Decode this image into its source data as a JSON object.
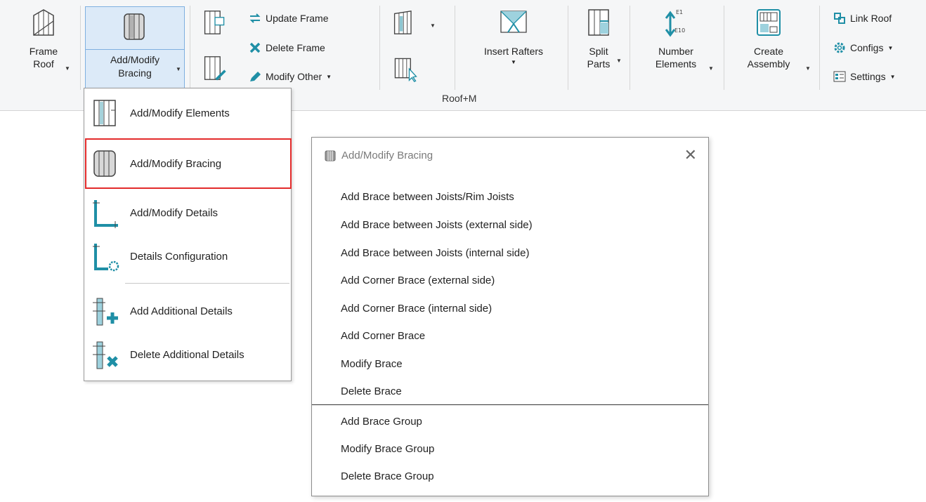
{
  "ribbon": {
    "frame_roof": {
      "line1": "Frame",
      "line2": "Roof"
    },
    "add_modify_bracing": {
      "line1": "Add/Modify",
      "line2": "Bracing"
    },
    "update_frame": "Update Frame",
    "delete_frame": "Delete Frame",
    "modify_other": "Modify Other",
    "insert_rafters": "Insert Rafters",
    "split_parts": {
      "line1": "Split",
      "line2": "Parts"
    },
    "number_elements": {
      "line1": "Number",
      "line2": "Elements",
      "icon_top": "E1",
      "icon_bottom": "E10"
    },
    "create_assembly": {
      "line1": "Create",
      "line2": "Assembly"
    },
    "link_roof": "Link Roof",
    "configs": "Configs",
    "settings": "Settings",
    "panel_label": "Roof+M"
  },
  "dropdown": {
    "items": [
      {
        "label": "Add/Modify  Elements",
        "icon": "elements-icon"
      },
      {
        "label": "Add/Modify  Bracing",
        "icon": "bracing-icon"
      },
      {
        "label": "Add/Modify  Details",
        "icon": "details-icon"
      },
      {
        "label": "Details  Configuration",
        "icon": "details-config-icon"
      },
      {
        "label": "Add Additional  Details",
        "icon": "add-details-icon"
      },
      {
        "label": "Delete Additional  Details",
        "icon": "delete-details-icon"
      }
    ]
  },
  "dialog": {
    "title": "Add/Modify Bracing",
    "options": [
      "Add Brace between Joists/Rim Joists",
      "Add Brace between Joists (external side)",
      "Add Brace between Joists (internal side)",
      "Add Corner Brace (external side)",
      "Add Corner Brace (internal side)",
      "Add Corner Brace",
      "Modify Brace",
      "Delete Brace"
    ],
    "group_options": [
      "Add Brace Group",
      "Modify Brace Group",
      "Delete Brace Group"
    ]
  },
  "colors": {
    "accent": "#1f8fa6",
    "selection_border": "#e32b2b",
    "hover_bg": "#dceaf8"
  }
}
